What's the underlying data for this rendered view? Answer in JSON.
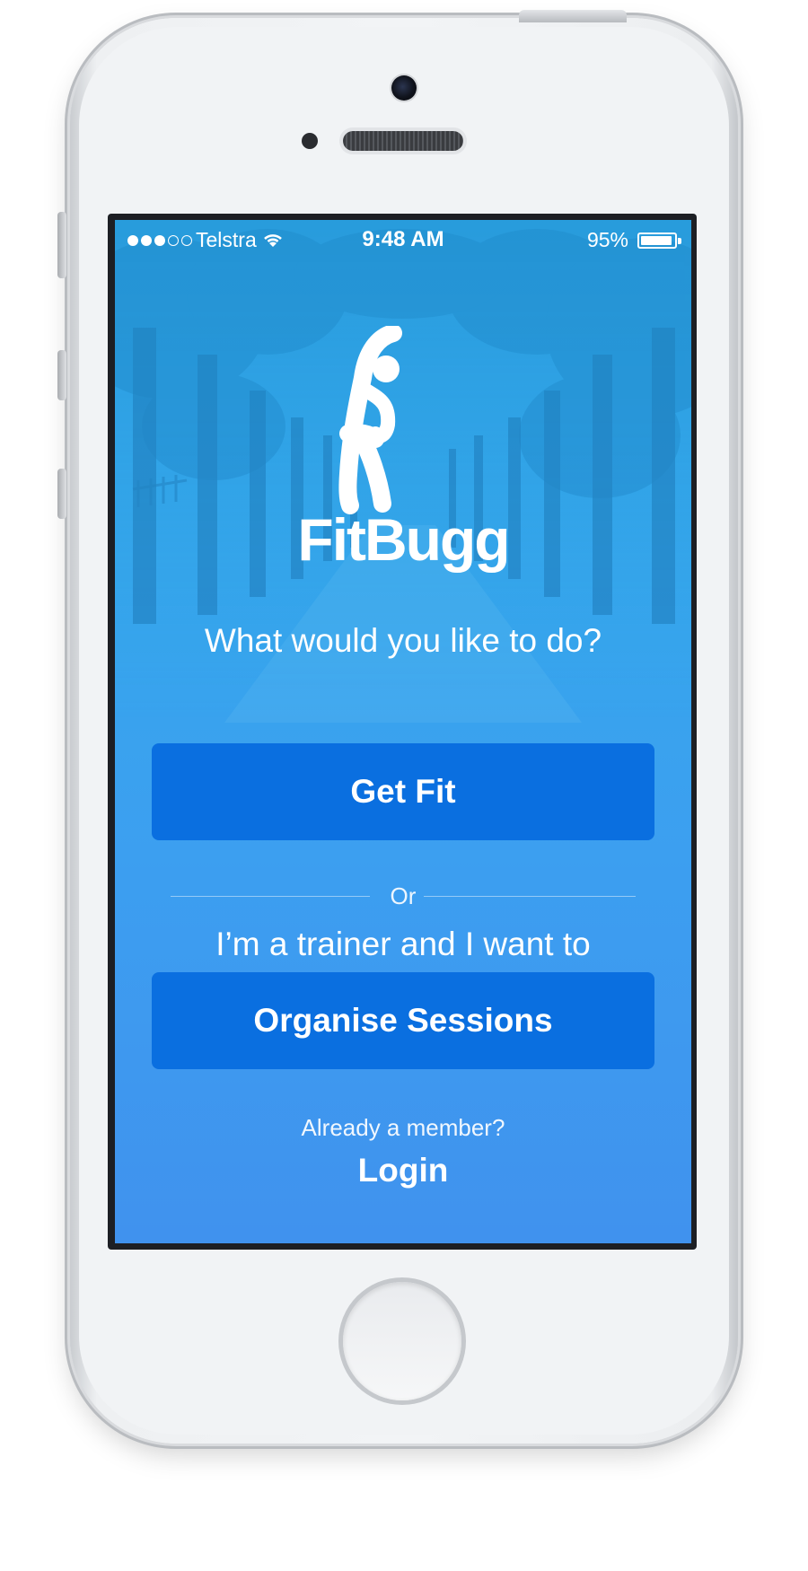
{
  "status_bar": {
    "signal": [
      "full",
      "full",
      "full",
      "empty",
      "empty"
    ],
    "carrier": "Telstra",
    "time": "9:48 AM",
    "battery_percent": "95%",
    "battery_level": 0.95
  },
  "brand": {
    "logo_icon": "stretching-person-icon",
    "name": "FitBugg"
  },
  "prompt": {
    "question": "What would you like to do?",
    "primary_button": "Get Fit",
    "divider": "Or",
    "trainer_text": "I’m a trainer and I want to",
    "secondary_button": "Organise Sessions"
  },
  "footer": {
    "member_text": "Already a member?",
    "login_link": "Login"
  },
  "colors": {
    "background_top": "#2fa8e8",
    "background_bottom": "#4092ee",
    "button": "#0a6fe0",
    "text": "#ffffff"
  }
}
